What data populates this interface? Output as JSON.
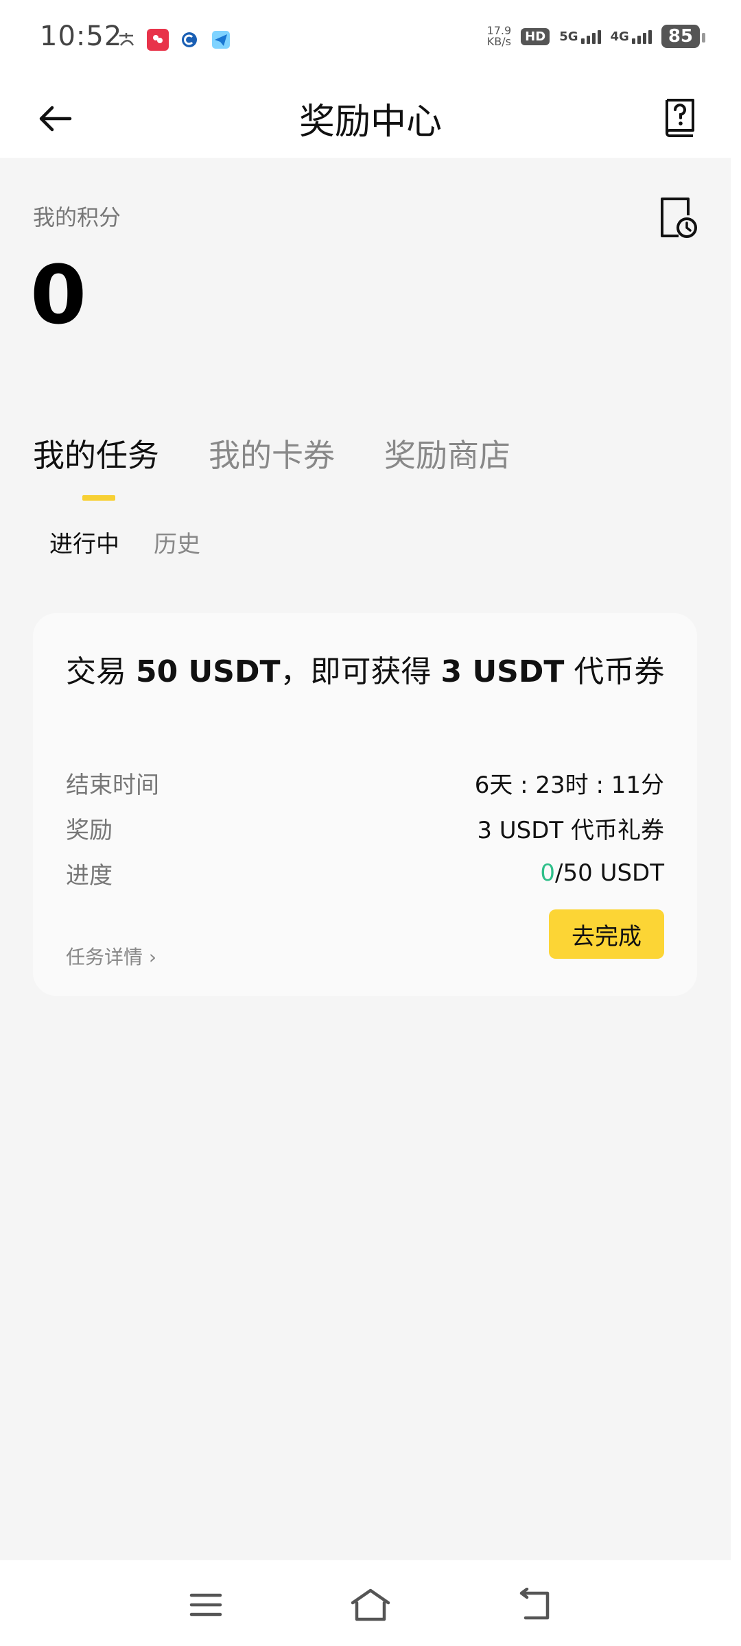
{
  "status_bar": {
    "time": "10:52",
    "speed_value": "17.9",
    "speed_unit": "KB/s",
    "hd": "HD",
    "net_5g": "5G",
    "net_4g": "4G",
    "battery": "85"
  },
  "header": {
    "title": "奖励中心"
  },
  "points": {
    "label": "我的积分",
    "value": "0"
  },
  "tabs": [
    {
      "label": "我的任务",
      "active": true
    },
    {
      "label": "我的卡券",
      "active": false
    },
    {
      "label": "奖励商店",
      "active": false
    }
  ],
  "subtabs": [
    {
      "label": "进行中",
      "active": true
    },
    {
      "label": "历史",
      "active": false
    }
  ],
  "task": {
    "title_prefix": "交易 ",
    "title_amount": "50 USDT",
    "title_middle": "，即可获得 ",
    "title_reward": "3 USDT",
    "title_suffix": " 代币券",
    "end_time_label": "结束时间",
    "end_time_value": "6天 : 23时 : 11分",
    "reward_label": "奖励",
    "reward_value": "3 USDT 代币礼券",
    "progress_label": "进度",
    "progress_done": "0",
    "progress_total": "/50 USDT",
    "detail_label": "任务详情 ›",
    "go_label": "去完成"
  },
  "colors": {
    "accent_yellow": "#fcd535",
    "progress_green": "#2fbf8a",
    "content_bg": "#f5f5f5"
  }
}
